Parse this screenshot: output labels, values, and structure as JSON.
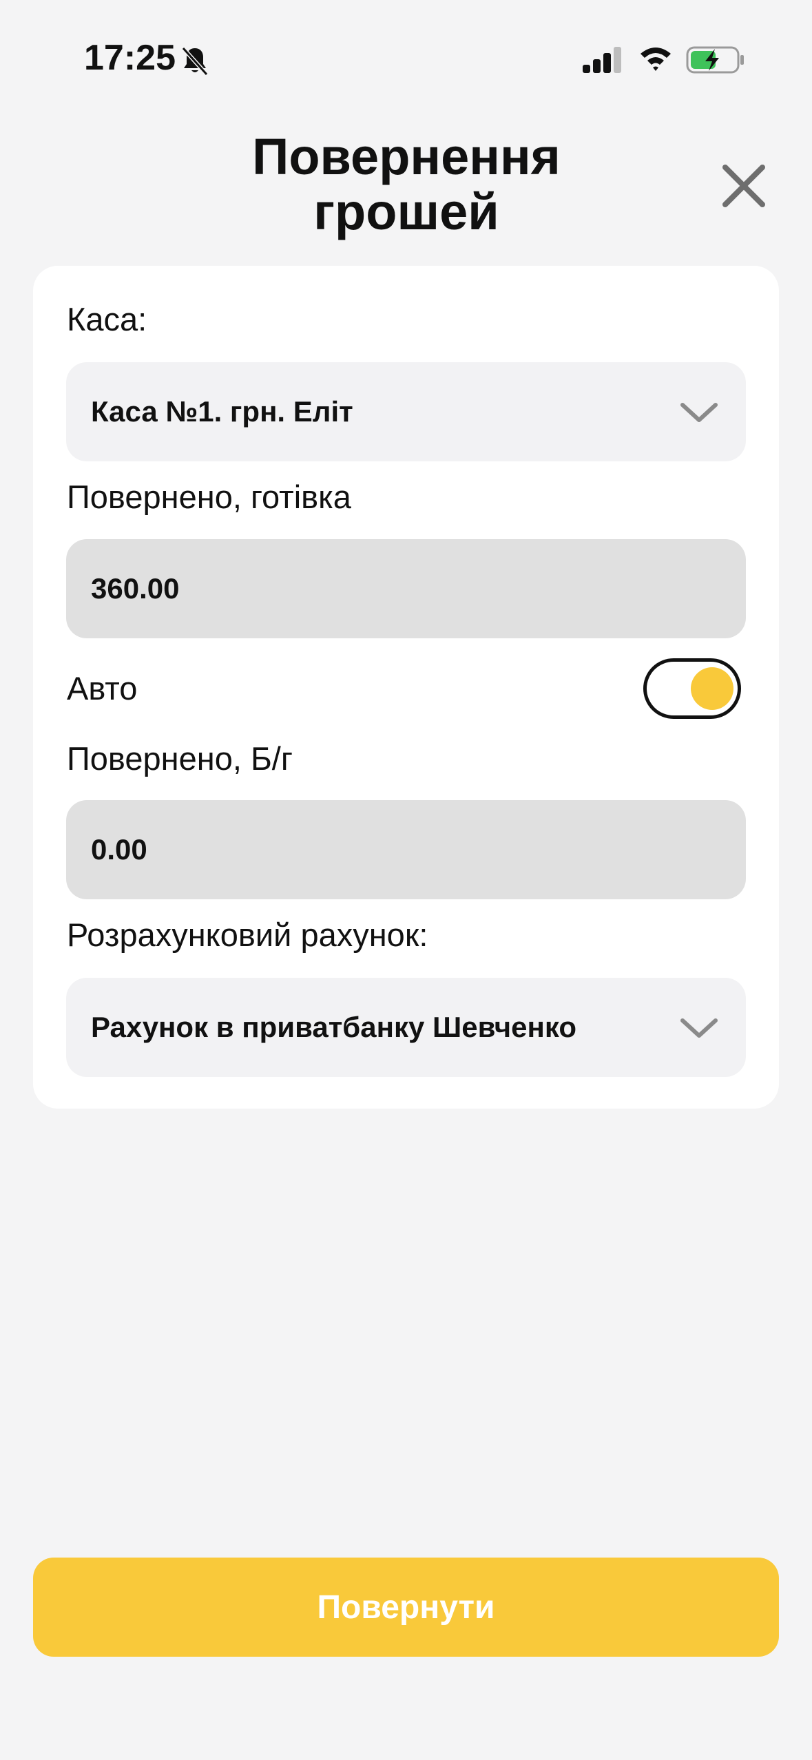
{
  "status_bar": {
    "time": "17:25",
    "icons": [
      "bell-muted-icon",
      "cellular-signal-icon",
      "wifi-icon",
      "battery-charging-icon"
    ],
    "battery_color": "#3ec25a"
  },
  "header": {
    "title_line1": "Повернення",
    "title_line2": "грошей",
    "close_icon": "close-icon"
  },
  "form": {
    "kasa_label": "Каса:",
    "kasa_value": "Каса №1. грн. Еліт",
    "cash_label": "Повернено, готівка",
    "cash_value": "360.00",
    "auto_label": "Авто",
    "auto_enabled": true,
    "noncash_label": "Повернено, Б/г",
    "noncash_value": "0.00",
    "account_label": "Розрахунковий рахунок:",
    "account_value": "Рахунок в приватбанку Шевченко"
  },
  "actions": {
    "submit_label": "Повернути"
  },
  "colors": {
    "accent": "#f9c93a",
    "background": "#f4f4f5",
    "card": "#ffffff",
    "select_bg": "#f2f2f4",
    "input_bg": "#e0e0e0"
  }
}
